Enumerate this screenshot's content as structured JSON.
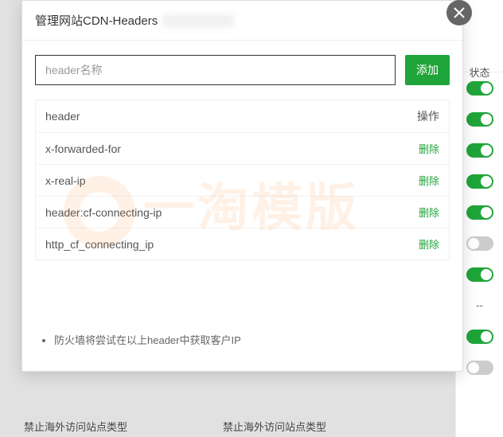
{
  "modal": {
    "title": "管理网站CDN-Headers",
    "input_placeholder": "header名称",
    "add_label": "添加",
    "col_header": "header",
    "col_op": "操作",
    "delete_label": "删除",
    "rows": [
      "x-forwarded-for",
      "x-real-ip",
      "header:cf-connecting-ip",
      "http_cf_connecting_ip"
    ],
    "note": "防火墙将尝试在以上header中获取客户IP"
  },
  "bg": {
    "status_header": "状态",
    "dash": "--",
    "toggles": [
      "on",
      "on",
      "on",
      "on",
      "on",
      "off",
      "on",
      "dash",
      "on",
      "off"
    ],
    "bottom_left": "禁止海外访问站点类型",
    "bottom_right": "禁止海外访问站点类型"
  },
  "watermark": "一淘模版"
}
